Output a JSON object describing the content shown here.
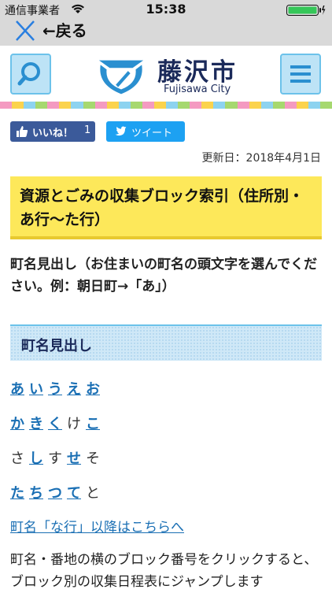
{
  "status": {
    "carrier": "通信事業者",
    "time": "15:38"
  },
  "nav": {
    "back_label": "←戻る"
  },
  "header": {
    "logo_jp": "藤沢市",
    "logo_en": "Fujisawa City"
  },
  "stripe_colors": [
    "#f49ac1",
    "#fbd34d",
    "#8dd3f0",
    "#a6d86f",
    "#f49ac1",
    "#fbd34d",
    "#8dd3f0",
    "#a6d86f",
    "#f49ac1",
    "#fbd34d",
    "#8dd3f0",
    "#a6d86f",
    "#f49ac1",
    "#fbd34d",
    "#8dd3f0",
    "#a6d86f",
    "#f49ac1",
    "#fbd34d",
    "#8dd3f0",
    "#a6d86f",
    "#f49ac1",
    "#fbd34d",
    "#8dd3f0",
    "#a6d86f",
    "#f49ac1",
    "#fbd34d",
    "#8dd3f0",
    "#a6d86f"
  ],
  "social": {
    "like_label": "いいね！",
    "like_count": "1",
    "tweet_label": "ツイート"
  },
  "page": {
    "updated": "更新日：2018年4月1日",
    "title": "資源とごみの収集ブロック索引（住所別・あ行～た行）",
    "description": "町名見出し（お住まいの町名の頭文字を選んでください。例：朝日町→「あ」）",
    "section_title": "町名見出し",
    "kana_rows": [
      [
        {
          "c": "あ",
          "link": true
        },
        {
          "c": "い",
          "link": true
        },
        {
          "c": "う",
          "link": true
        },
        {
          "c": "え",
          "link": true
        },
        {
          "c": "お",
          "link": true
        }
      ],
      [
        {
          "c": "か",
          "link": true
        },
        {
          "c": "き",
          "link": true
        },
        {
          "c": "く",
          "link": true
        },
        {
          "c": "け",
          "link": false
        },
        {
          "c": "こ",
          "link": true
        }
      ],
      [
        {
          "c": "さ",
          "link": false
        },
        {
          "c": "し",
          "link": true
        },
        {
          "c": "す",
          "link": false
        },
        {
          "c": "せ",
          "link": true
        },
        {
          "c": "そ",
          "link": false
        }
      ],
      [
        {
          "c": "た",
          "link": true
        },
        {
          "c": "ち",
          "link": true
        },
        {
          "c": "つ",
          "link": true
        },
        {
          "c": "て",
          "link": true
        },
        {
          "c": "と",
          "link": false
        }
      ]
    ],
    "next_link": "町名「な行」以降はこちらへ",
    "bottom_text": "町名・番地の横のブロック番号をクリックすると、ブロック別の収集日程表にジャンプします"
  },
  "colors": {
    "link": "#1a6fb4",
    "title_bg": "#fde85a",
    "accent_blue": "#6cc2ea",
    "navy": "#1b2a5a"
  }
}
